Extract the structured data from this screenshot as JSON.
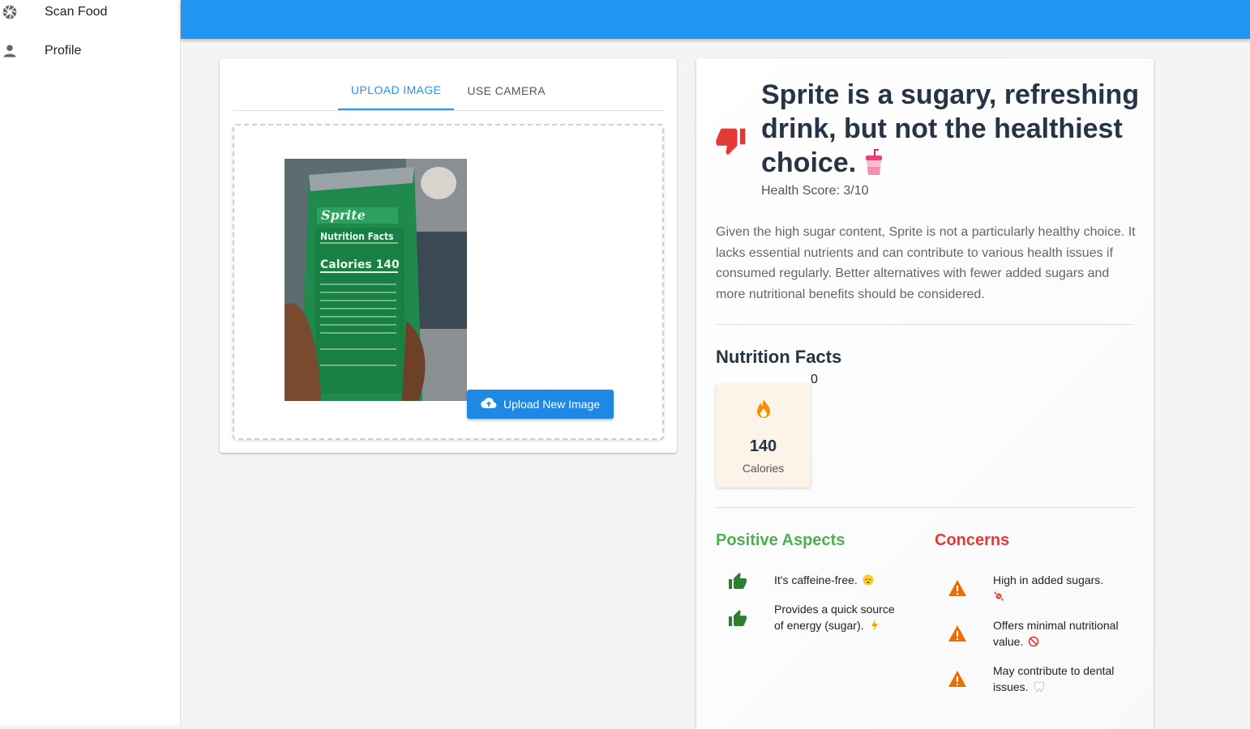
{
  "sidebar": {
    "items": [
      {
        "label": "Scan Food",
        "icon": "camera-aperture-icon"
      },
      {
        "label": "Profile",
        "icon": "person-icon"
      }
    ]
  },
  "colors": {
    "appbar": "#2196f3",
    "positive": "#4caf50",
    "concern": "#e53935",
    "verdict": "#e53935",
    "warning": "#ef6c00"
  },
  "upload": {
    "tabs": [
      {
        "label": "UPLOAD IMAGE",
        "active": true
      },
      {
        "label": "USE CAMERA",
        "active": false
      }
    ],
    "button_label": "Upload New Image",
    "button_icon": "cloud-upload-icon"
  },
  "result": {
    "verdict_icon": "thumb-down-icon",
    "headline": "Sprite is a sugary, refreshing drink, but not the healthiest choice.",
    "headline_emoji": "cup-with-straw",
    "health_score": "Health Score: 3/10",
    "description": "Given the high sugar content, Sprite is not a particularly healthy choice. It lacks essential nutrients and can contribute to various health issues if consumed regularly. Better alternatives with fewer added sugars and more nutritional benefits should be considered.",
    "nutrition": {
      "title": "Nutrition Facts",
      "stray_value": "0",
      "items": [
        {
          "value": "140",
          "label": "Calories",
          "icon": "flame-icon"
        }
      ]
    },
    "positives": {
      "title": "Positive Aspects",
      "items": [
        {
          "text": "It's caffeine-free.",
          "emoji": "sleeping-face"
        },
        {
          "text": "Provides a quick source of energy (sugar).",
          "emoji": "lightning"
        }
      ]
    },
    "concerns": {
      "title": "Concerns",
      "items": [
        {
          "text": "High in added sugars.",
          "emoji": "candy"
        },
        {
          "text": "Offers minimal nutritional value.",
          "emoji": "prohibited"
        },
        {
          "text": "May contribute to dental issues.",
          "emoji": "tooth"
        }
      ]
    }
  }
}
